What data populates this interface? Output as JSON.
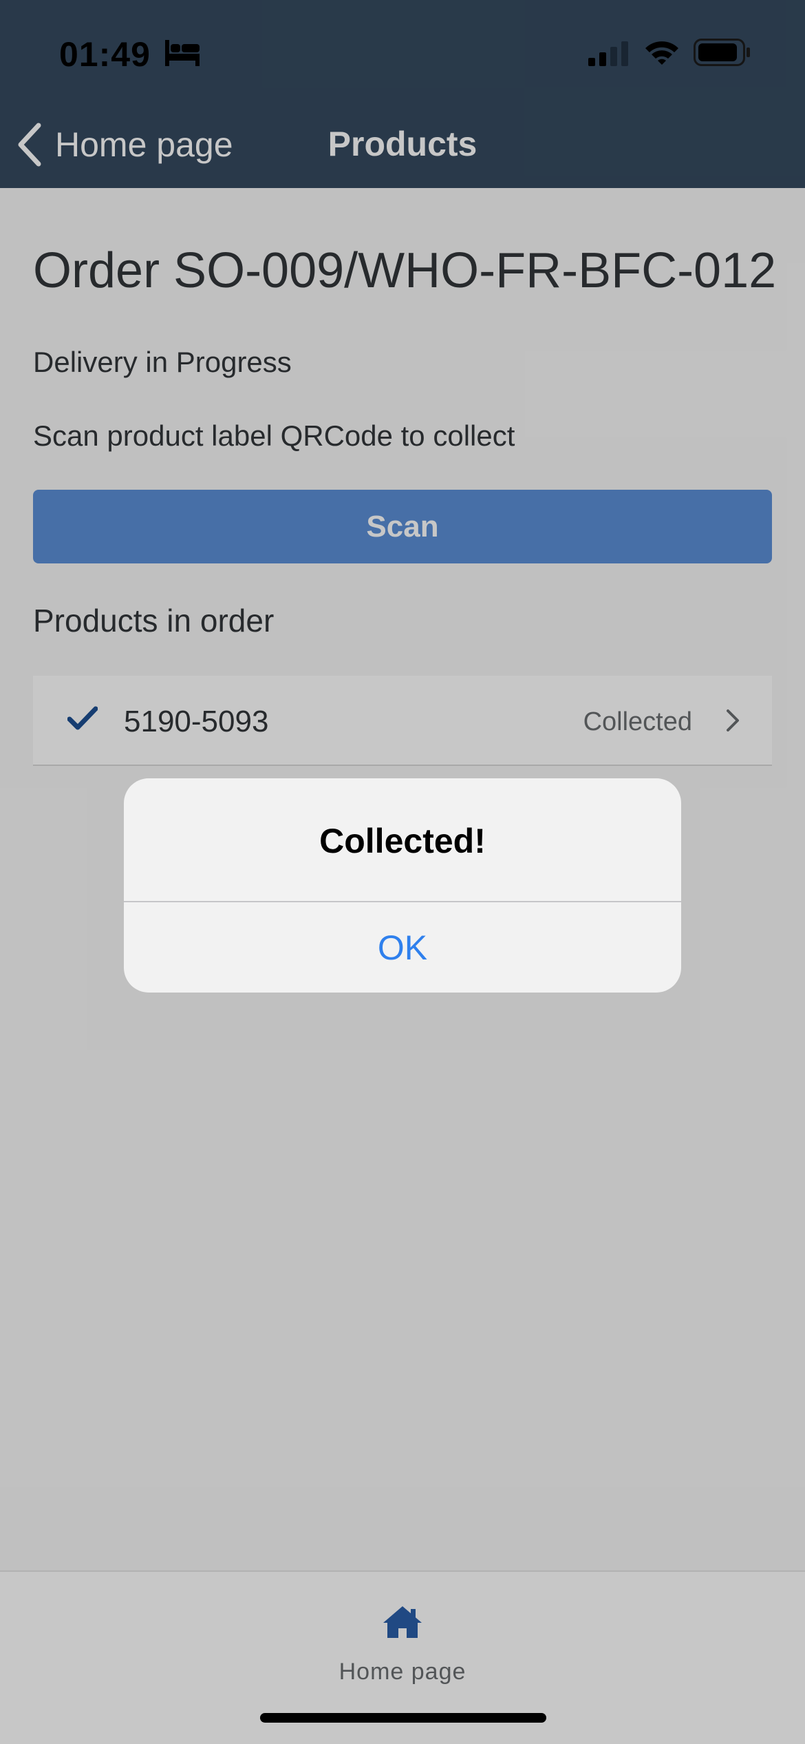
{
  "status_bar": {
    "time": "01:49",
    "icons": [
      "bed-icon",
      "cellular-signal-icon",
      "wifi-icon",
      "battery-icon"
    ]
  },
  "nav_bar": {
    "back_label": "Home page",
    "title": "Products"
  },
  "order": {
    "title": "Order SO-009/WHO-FR-BFC-012",
    "status": "Delivery in Progress",
    "instruction": "Scan product label QRCode to collect",
    "scan_label": "Scan"
  },
  "products_section": {
    "title": "Products in order",
    "items": [
      {
        "id": "5190-5093",
        "status": "Collected",
        "checked": true
      }
    ]
  },
  "tab_bar": {
    "items": [
      {
        "label": "Home page",
        "icon": "home-icon",
        "active": true
      }
    ]
  },
  "alert": {
    "title": "Collected!",
    "ok_label": "OK"
  },
  "colors": {
    "nav_background": "#354a5f",
    "scan_button": "#5c8fd6",
    "accent_blue": "#2f80ed",
    "check_blue": "#1d4f91"
  }
}
